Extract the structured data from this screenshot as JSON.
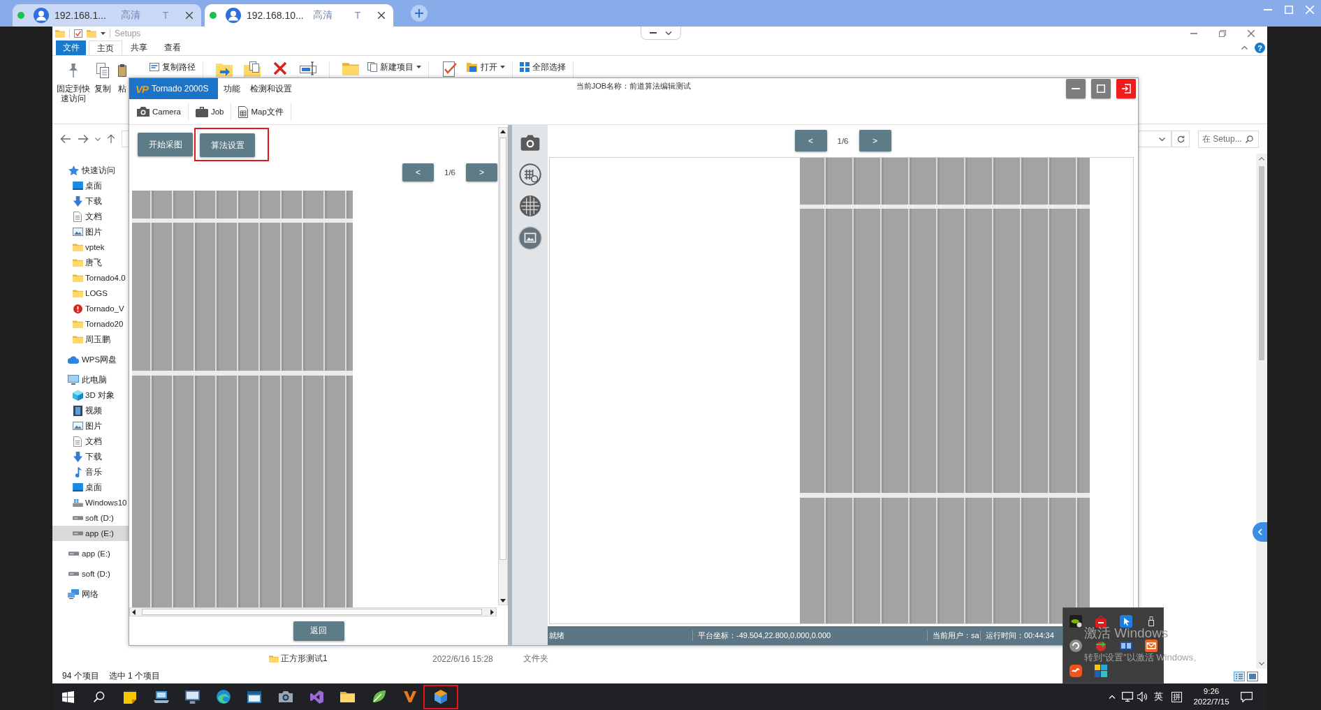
{
  "browser": {
    "tabs": [
      {
        "title": "192.168.1...",
        "quality": "高清",
        "mark": "T",
        "selected": false
      },
      {
        "title": "192.168.10...",
        "quality": "高清",
        "mark": "T",
        "selected": true
      }
    ]
  },
  "explorer": {
    "title": "Setups",
    "ribbon_tabs": [
      {
        "label": "文件",
        "kind": "menu",
        "selected": false
      },
      {
        "label": "主页",
        "kind": "tab",
        "selected": true
      },
      {
        "label": "共享",
        "kind": "tab",
        "selected": false
      },
      {
        "label": "查看",
        "kind": "tab",
        "selected": false
      }
    ],
    "help": "?",
    "ribbon": [
      {
        "items": [
          {
            "kind": "pin",
            "label": "固定到快速访问"
          },
          {
            "kind": "copy",
            "label": "复制"
          },
          {
            "kind": "paste",
            "label": "粘"
          },
          {
            "kind": "copy-path",
            "label": "复制路径",
            "dropdown": false
          }
        ]
      },
      {
        "items": [
          {
            "kind": "move-to"
          },
          {
            "kind": "copy-to"
          },
          {
            "kind": "delete"
          },
          {
            "kind": "rename"
          }
        ]
      },
      {
        "items": [
          {
            "kind": "new-folder"
          },
          {
            "kind": "new-item",
            "label": "新建项目",
            "dropdown": true
          }
        ]
      },
      {
        "items": [
          {
            "kind": "properties"
          },
          {
            "kind": "open",
            "label": "打开",
            "dropdown": true
          }
        ]
      },
      {
        "items": [
          {
            "kind": "select-all",
            "label": "全部选择",
            "dropdown": false
          }
        ]
      }
    ],
    "search": {
      "placeholder": "在 Setup..."
    },
    "nav": [
      {
        "label": "快速访问",
        "kind": "star",
        "selected": false,
        "children": [
          {
            "label": "桌面",
            "kind": "desktop",
            "selected": false
          },
          {
            "label": "下载",
            "kind": "download",
            "selected": false
          },
          {
            "label": "文档",
            "kind": "document",
            "selected": false
          },
          {
            "label": "图片",
            "kind": "picture",
            "selected": false
          },
          {
            "label": "vptek",
            "kind": "folder",
            "selected": false
          },
          {
            "label": "唐飞",
            "kind": "folder",
            "selected": false
          },
          {
            "label": "Tornado4.0",
            "kind": "folder",
            "selected": false
          },
          {
            "label": "LOGS",
            "kind": "folder",
            "selected": false
          },
          {
            "label": "Tornado_V",
            "kind": "warning",
            "selected": false
          },
          {
            "label": "Tornado20",
            "kind": "folder",
            "selected": false
          },
          {
            "label": "周玉鹏",
            "kind": "folder",
            "selected": false
          }
        ]
      },
      {
        "label": "WPS网盘",
        "kind": "cloud",
        "selected": false
      },
      {
        "label": "此电脑",
        "kind": "computer",
        "selected": false,
        "children": [
          {
            "label": "3D 对象",
            "kind": "cube",
            "selected": false
          },
          {
            "label": "视频",
            "kind": "video",
            "selected": false
          },
          {
            "label": "图片",
            "kind": "picture",
            "selected": false
          },
          {
            "label": "文档",
            "kind": "document",
            "selected": false
          },
          {
            "label": "下载",
            "kind": "download",
            "selected": false
          },
          {
            "label": "音乐",
            "kind": "music",
            "selected": false
          },
          {
            "label": "桌面",
            "kind": "desktop",
            "selected": false
          },
          {
            "label": "Windows10",
            "kind": "system-drive",
            "selected": false
          },
          {
            "label": "soft (D:)",
            "kind": "drive",
            "selected": false
          },
          {
            "label": "app (E:)",
            "kind": "drive",
            "selected": true
          }
        ]
      },
      {
        "label": "app (E:)",
        "kind": "drive",
        "selected": false
      },
      {
        "label": "soft (D:)",
        "kind": "drive",
        "selected": false
      },
      {
        "label": "网络",
        "kind": "network",
        "selected": false
      }
    ],
    "files": [
      {
        "name": "正方形测试1",
        "date": "2022/6/16 15:28",
        "type": "文件夹"
      }
    ],
    "status": [
      "94 个项目",
      "选中 1 个项目"
    ]
  },
  "app": {
    "logo": {
      "mark": "VP",
      "name": "Tornado 2000S"
    },
    "menu": [
      "功能",
      "检测和设置"
    ],
    "job": "当前JOB名称：前道算法编辑测试",
    "toolbar": [
      {
        "kind": "camera",
        "label": "Camera"
      },
      {
        "kind": "job",
        "label": "Job"
      },
      {
        "kind": "map",
        "label": "Map文件"
      }
    ],
    "actions": [
      {
        "label": "开始采图",
        "highlighted": false
      },
      {
        "label": "算法设置",
        "highlighted": true
      }
    ],
    "left_pager": {
      "prev": "<",
      "page": "1/6",
      "next": ">"
    },
    "back": "返回",
    "tools": [
      {
        "kind": "camera",
        "selected": false
      },
      {
        "kind": "crosshair",
        "selected": false
      },
      {
        "kind": "grid",
        "selected": false
      },
      {
        "kind": "image",
        "selected": true
      }
    ],
    "right_pager": {
      "prev": "<",
      "page": "1/6",
      "next": ">"
    },
    "status": [
      "就绪",
      "平台坐标：-49.504,22.800,0.000,0.000",
      "当前用户：sa",
      "运行时间：00:44:34"
    ]
  },
  "taskbar": {
    "apps": [
      {
        "kind": "start",
        "highlighted": false
      },
      {
        "kind": "search",
        "highlighted": false
      },
      {
        "kind": "notes",
        "highlighted": false
      },
      {
        "kind": "laptop",
        "highlighted": false
      },
      {
        "kind": "monitor",
        "highlighted": false
      },
      {
        "kind": "browser",
        "highlighted": false
      },
      {
        "kind": "window",
        "highlighted": false
      },
      {
        "kind": "camera",
        "highlighted": false
      },
      {
        "kind": "bow",
        "highlighted": false
      },
      {
        "kind": "folder",
        "highlighted": false
      },
      {
        "kind": "leaf",
        "highlighted": false
      },
      {
        "kind": "chevron",
        "highlighted": false
      },
      {
        "kind": "cube",
        "highlighted": true
      }
    ],
    "ime": "英",
    "ime_mode": "拼",
    "time": "9:26",
    "date": "2022/7/15",
    "tray_popup": [
      {
        "kind": "eye"
      },
      {
        "kind": "bag"
      },
      {
        "kind": "cursor"
      },
      {
        "kind": "usb"
      },
      {
        "kind": "disc"
      },
      {
        "kind": "arrow"
      },
      {
        "kind": "panel"
      },
      {
        "kind": "mail"
      },
      {
        "kind": "wave"
      },
      {
        "kind": "blocks"
      }
    ]
  },
  "activation": [
    "激活 Windows",
    "转到“设置”以激活 Windows。"
  ]
}
